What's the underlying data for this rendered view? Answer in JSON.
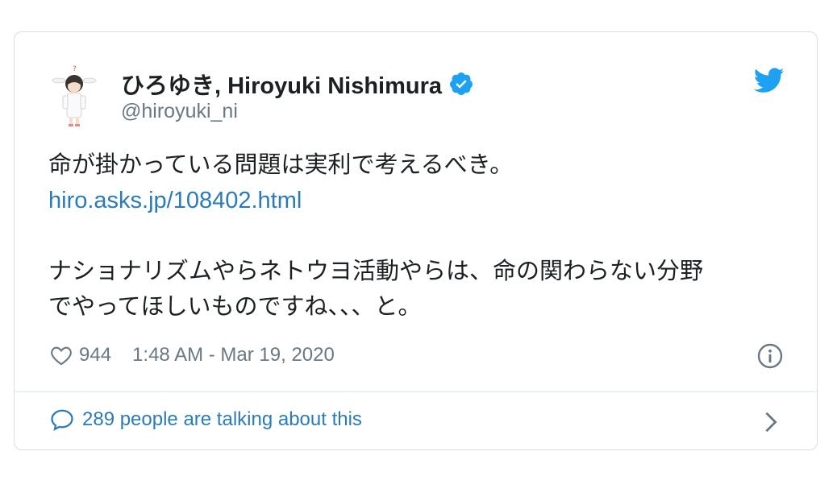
{
  "user": {
    "display_name": "ひろゆき, Hiroyuki Nishimura",
    "handle": "@hiroyuki_ni",
    "verified": true
  },
  "tweet": {
    "line1": "命が掛かっている問題は実利で考えるべき。",
    "link": "hiro.asks.jp/108402.html",
    "line2": "ナショナリズムやらネトウヨ活動やらは、命の関わらない分野",
    "line3": "でやってほしいものですね、、、と。"
  },
  "meta": {
    "like_count": "944",
    "timestamp": "1:48 AM - Mar 19, 2020"
  },
  "footer": {
    "conversation": "289 people are talking about this"
  },
  "icons": {
    "verified": "verified-badge-icon",
    "bird": "twitter-bird-icon",
    "heart": "heart-icon",
    "info": "info-icon",
    "bubble": "comment-bubble-icon",
    "chevron": "chevron-right-icon"
  },
  "colors": {
    "accent": "#1da1f2",
    "link": "#2b7bb9",
    "text": "#1c2022",
    "muted": "#697882",
    "border": "#d9dee3"
  }
}
